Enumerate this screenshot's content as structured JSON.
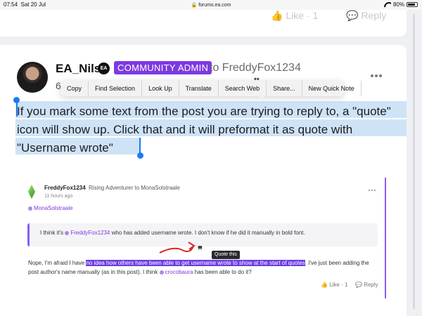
{
  "status_bar": {
    "time": "07:54",
    "date": "Sat 20 Jul",
    "url": "forums.ea.com",
    "battery": "80%"
  },
  "prev_post": {
    "likes_label": "Like · 1",
    "reply_label": "Reply"
  },
  "post": {
    "author": "EA_Nils",
    "badge_icon": "EA",
    "role": "COMMUNITY ADMIN",
    "to_label": "to FreddyFox1234",
    "meta": "6",
    "body": "If you mark some text from the post you are trying to reply to, a \"quote\" icon will show up. Click that and it will preformat it as quote with \"Username wrote\""
  },
  "context_menu": {
    "items": [
      "Copy",
      "Find Selection",
      "Look Up",
      "Translate",
      "Search Web",
      "Share...",
      "New Quick Note"
    ]
  },
  "embedded": {
    "author": "FreddyFox1234",
    "rank": "Rising Adventurer to MonaSolstraale",
    "time": "11 hours ago",
    "mention": "MonaSolstraale",
    "quote_before": "I think it's ",
    "quote_mention": "FreddyFox1234",
    "quote_after": " who has added username wrote. I don't know if he did it manually in bold font.",
    "tooltip": "Quote this",
    "quote_icon": "❞",
    "body_before": "Nope, I'm afraid I have ",
    "body_highlight": "no idea how others have been able to get username wrote to show at the start of quotes",
    "body_after": ". I've just been adding the post author's name manually (as in this post). I think ",
    "body_mention": "crocobaura",
    "body_end": " has been able to do it?",
    "like": "Like · 1",
    "reply": "Reply"
  },
  "colors": {
    "accent": "#7d39e0",
    "selection": "#cfe3f7",
    "handle": "#1a7cf0",
    "highlight": "#6c3ee0"
  }
}
